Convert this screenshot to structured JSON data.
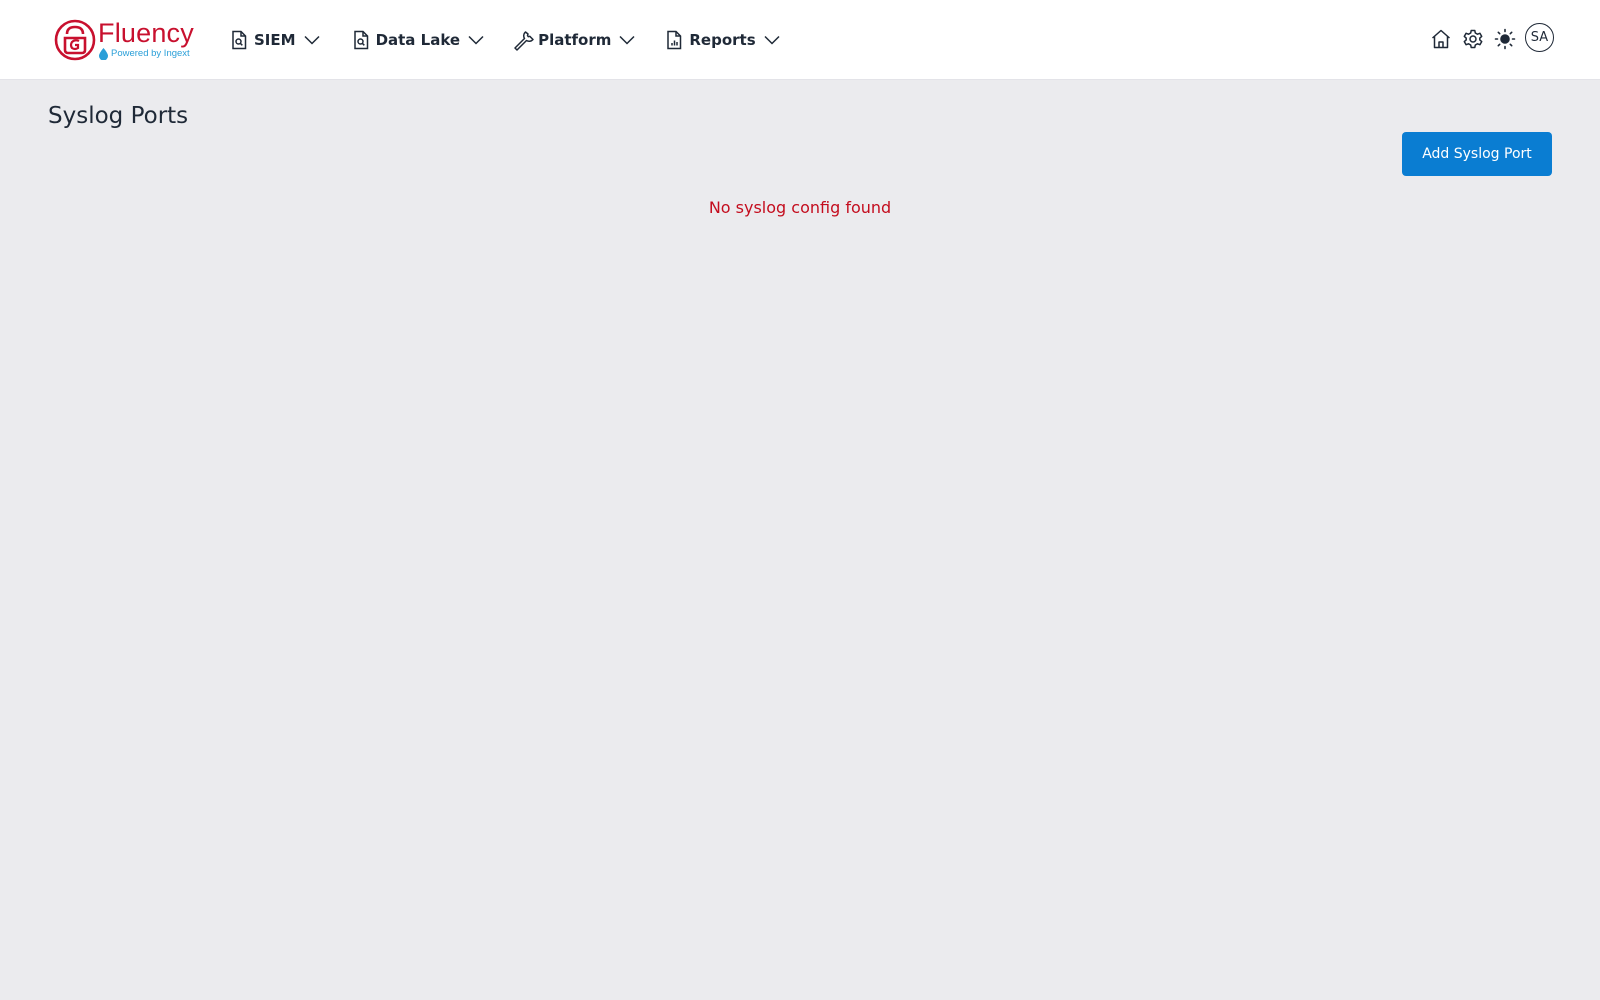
{
  "brand": {
    "name": "Fluency",
    "tagline": "Powered by Ingext",
    "primary_color": "#c8102e",
    "accent_color": "#2a9fd8"
  },
  "nav": {
    "items": [
      {
        "label": "SIEM",
        "icon": "file-search-icon"
      },
      {
        "label": "Data Lake",
        "icon": "file-search-icon"
      },
      {
        "label": "Platform",
        "icon": "wrench-icon"
      },
      {
        "label": "Reports",
        "icon": "file-chart-icon"
      }
    ]
  },
  "header_actions": {
    "icons": [
      "home-icon",
      "gear-icon",
      "sun-icon"
    ],
    "avatar_initials": "SA"
  },
  "page": {
    "title": "Syslog Ports",
    "add_button_label": "Add Syslog Port",
    "add_button_color": "#0a7dd2",
    "empty_message": "No syslog config found",
    "empty_message_color": "#c40d1e",
    "background_color": "#ebebee"
  }
}
